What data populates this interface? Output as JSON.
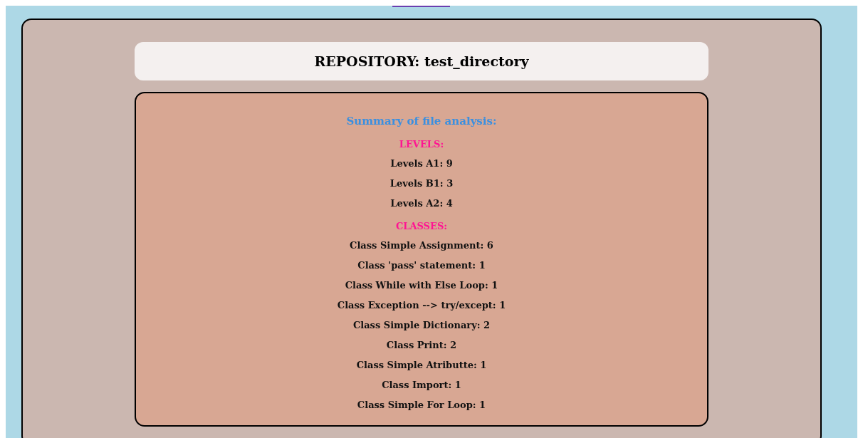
{
  "repository_title": "REPOSITORY: test_directory",
  "summary": {
    "heading": "Summary of file analysis:",
    "sections": [
      {
        "title": "LEVELS:",
        "items": [
          "Levels A1: 9",
          "Levels B1: 3",
          "Levels A2: 4"
        ]
      },
      {
        "title": "CLASSES:",
        "items": [
          "Class Simple Assignment: 6",
          "Class 'pass' statement: 1",
          "Class While with Else Loop: 1",
          "Class Exception --> try/except: 1",
          "Class Simple Dictionary: 2",
          "Class Print: 2",
          "Class Simple Atributte: 1",
          "Class Import: 1",
          "Class Simple For Loop: 1"
        ]
      }
    ]
  }
}
